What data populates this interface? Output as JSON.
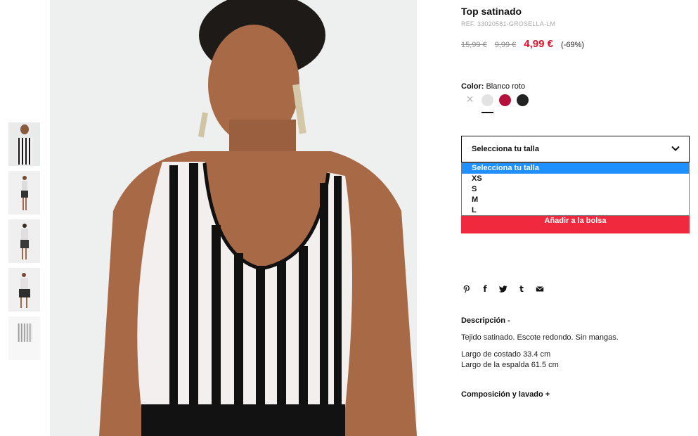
{
  "product": {
    "title": "Top satinado",
    "ref": "REF. 33020581-GROSELLA-LM",
    "price_original": "15,99 €",
    "price_previous": "9,99 €",
    "price_current": "4,99 €",
    "discount": "(-69%)"
  },
  "color": {
    "label": "Color:",
    "value": "Blanco roto",
    "swatches": [
      {
        "name": "unavailable",
        "hex": "#ffffff"
      },
      {
        "name": "blanco roto",
        "hex": "#e3e3e3"
      },
      {
        "name": "grosella",
        "hex": "#b5113a"
      },
      {
        "name": "negro",
        "hex": "#222222"
      }
    ]
  },
  "size_select": {
    "placeholder": "Selecciona tu talla",
    "options": [
      "Selecciona tu talla",
      "XS",
      "S",
      "M",
      "L"
    ]
  },
  "add_to_bag": "Añadir a la bolsa",
  "social": {
    "icons": [
      "pinterest-icon",
      "facebook-icon",
      "twitter-icon",
      "tumblr-icon",
      "email-icon"
    ],
    "facebook_glyph": "f",
    "tumblr_glyph": "t"
  },
  "description": {
    "title": "Descripción -",
    "text": "Tejido satinado. Escote redondo. Sin mangas.",
    "measure_1": "Largo de costado 33.4 cm",
    "measure_2": "Largo de la espalda 61.5 cm"
  },
  "composition": {
    "title": "Composición y lavado +"
  },
  "colors": {
    "accent_red": "#e20f2b",
    "button_red": "#f0293e",
    "highlight_blue": "#1e90ff"
  }
}
